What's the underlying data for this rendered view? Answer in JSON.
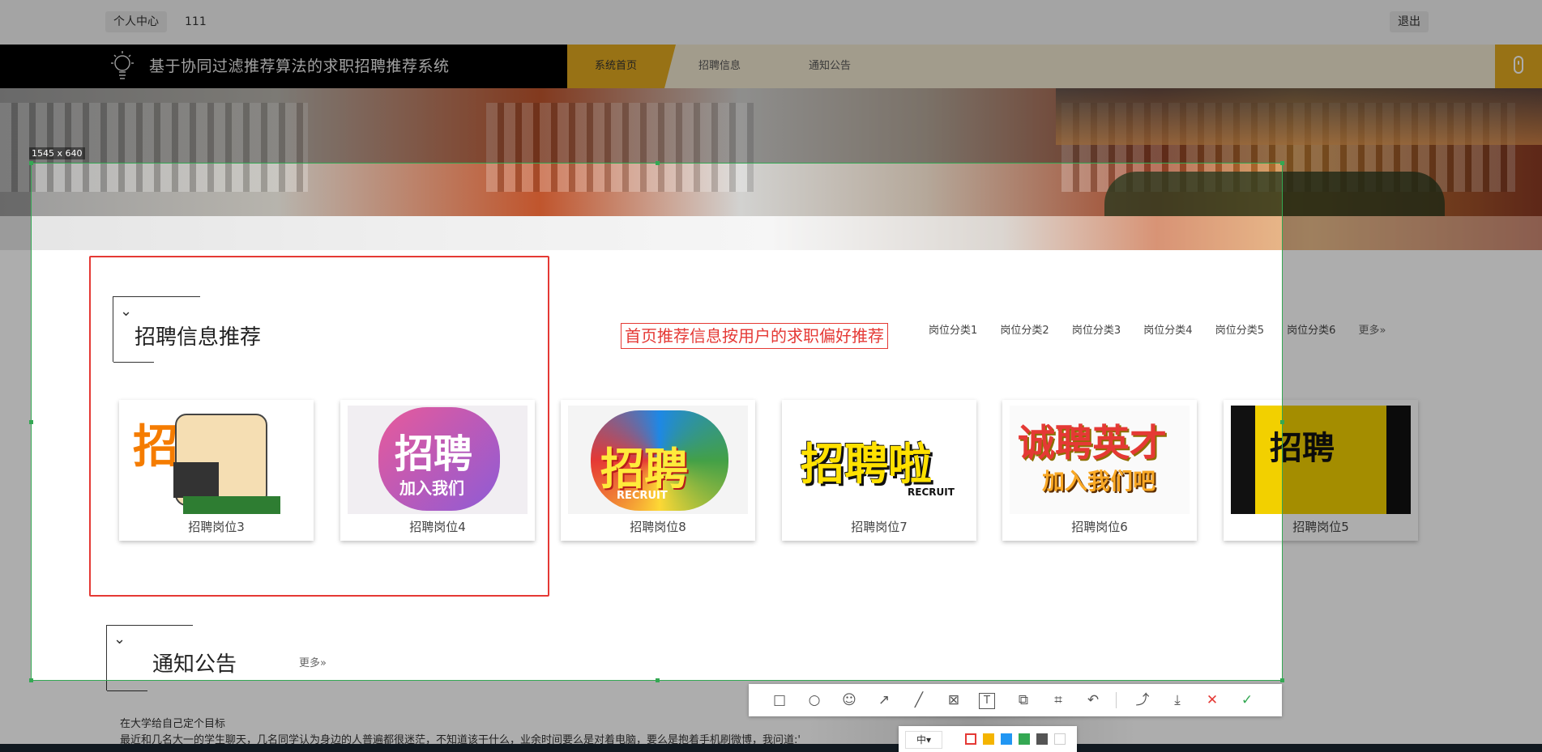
{
  "topbar": {
    "user_center": "个人中心",
    "username": "111",
    "logout": "退出"
  },
  "header": {
    "title": "基于协同过滤推荐算法的求职招聘推荐系统",
    "nav": [
      "系统首页",
      "招聘信息",
      "通知公告"
    ]
  },
  "capture": {
    "size_label": "1545 x 640"
  },
  "recommend": {
    "title": "招聘信息推荐",
    "annotation": "首页推荐信息按用户的求职偏好推荐",
    "categories": [
      "岗位分类1",
      "岗位分类2",
      "岗位分类3",
      "岗位分类4",
      "岗位分类5",
      "岗位分类6"
    ],
    "more": "更多»",
    "cards": [
      {
        "caption": "招聘岗位3",
        "image_text": "招"
      },
      {
        "caption": "招聘岗位4",
        "image_text": "招聘",
        "image_sub": "加入我们"
      },
      {
        "caption": "招聘岗位8",
        "image_text": "招聘",
        "image_sub": "RECRUIT"
      },
      {
        "caption": "招聘岗位7",
        "image_text": "招聘啦",
        "image_sub": "RECRUIT"
      },
      {
        "caption": "招聘岗位6",
        "image_text": "诚聘英才",
        "image_sub": "加入我们吧"
      },
      {
        "caption": "招聘岗位5",
        "image_text": "招聘"
      }
    ]
  },
  "notice": {
    "title": "通知公告",
    "more": "更多»",
    "item_title": "在大学给自己定个目标",
    "item_excerpt": "最近和几名大一的学生聊天，几名同学认为身边的人普遍都很迷茫，不知道该干什么，业余时间要么是对着电脑，要么是抱着手机刷微博，我问道:\"为"
  },
  "toolbar": {
    "icons": [
      "rectangle-icon",
      "circle-icon",
      "emoji-icon",
      "arrow-icon",
      "line-icon",
      "mosaic-icon",
      "text-icon",
      "copy-icon",
      "ocr-icon",
      "undo-icon",
      "share-icon",
      "download-icon",
      "cancel-icon",
      "confirm-icon"
    ],
    "glyphs": [
      "□",
      "○",
      "☺",
      "↗",
      "╱",
      "⊠",
      "T",
      "⧉",
      "⌗",
      "↶",
      "⤴",
      "⤓",
      "✕",
      "✓"
    ],
    "size_label": "中▾",
    "colors": [
      "#e53935",
      "#f4b400",
      "#2196f3",
      "#34a853",
      "#555555",
      "#ffffff"
    ]
  }
}
